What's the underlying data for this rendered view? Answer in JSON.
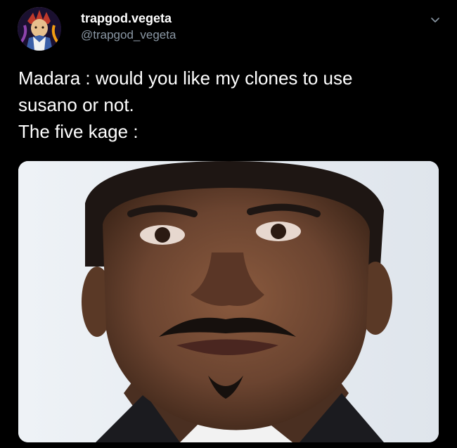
{
  "tweet": {
    "display_name": "trapgod.vegeta",
    "handle": "@trapgod_vegeta",
    "text_lines": [
      "Madara : would you like my clones to use",
      "susano or not.",
      "The five kage :"
    ]
  },
  "icons": {
    "avatar": "anime-character-avatar",
    "menu": "chevron-down-icon"
  },
  "colors": {
    "background": "#000000",
    "primary_text": "#ffffff",
    "secondary_text": "#8b98a5"
  }
}
